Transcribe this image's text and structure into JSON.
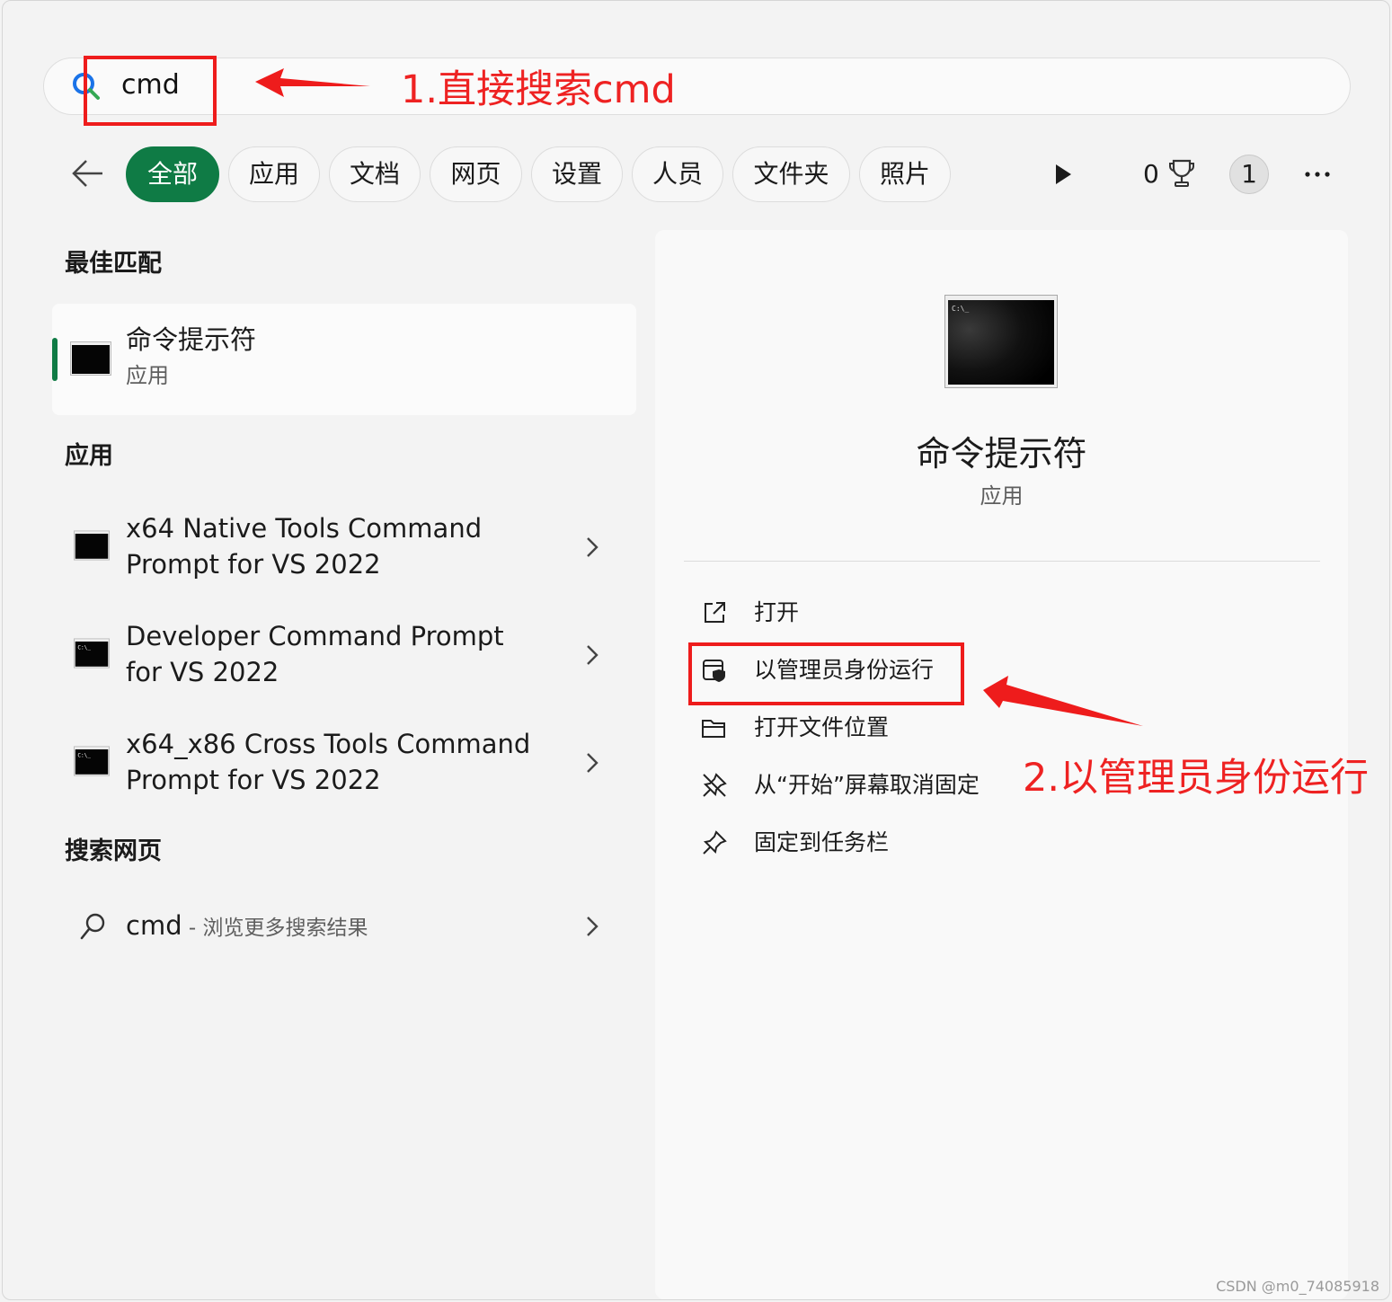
{
  "search": {
    "query": "cmd"
  },
  "filters": {
    "items": [
      {
        "label": "全部",
        "active": true
      },
      {
        "label": "应用"
      },
      {
        "label": "文档"
      },
      {
        "label": "网页"
      },
      {
        "label": "设置"
      },
      {
        "label": "人员"
      },
      {
        "label": "文件夹"
      },
      {
        "label": "照片"
      }
    ],
    "points": "0",
    "avatar": "1"
  },
  "results": {
    "best_heading": "最佳匹配",
    "best": {
      "title": "命令提示符",
      "subtitle": "应用"
    },
    "apps_heading": "应用",
    "apps": [
      {
        "line1": "x64 Native Tools Command",
        "line2": "Prompt for VS 2022"
      },
      {
        "line1": "Developer Command Prompt",
        "line2": "for VS 2022"
      },
      {
        "line1": "x64_x86 Cross Tools Command",
        "line2": "Prompt for VS 2022"
      }
    ],
    "web_heading": "搜索网页",
    "web": {
      "query": "cmd",
      "hint": " - 浏览更多搜索结果"
    }
  },
  "preview": {
    "title": "命令提示符",
    "subtitle": "应用",
    "actions": [
      {
        "label": "打开"
      },
      {
        "label": "以管理员身份运行"
      },
      {
        "label": "打开文件位置"
      },
      {
        "label": "从“开始”屏幕取消固定"
      },
      {
        "label": "固定到任务栏"
      }
    ]
  },
  "annotations": {
    "step1": "1.直接搜索cmd",
    "step2": "2.以管理员身份运行",
    "color": "#ee1c1c"
  },
  "watermark": "CSDN @m0_74085918",
  "colors": {
    "accent": "#0f7b45"
  }
}
